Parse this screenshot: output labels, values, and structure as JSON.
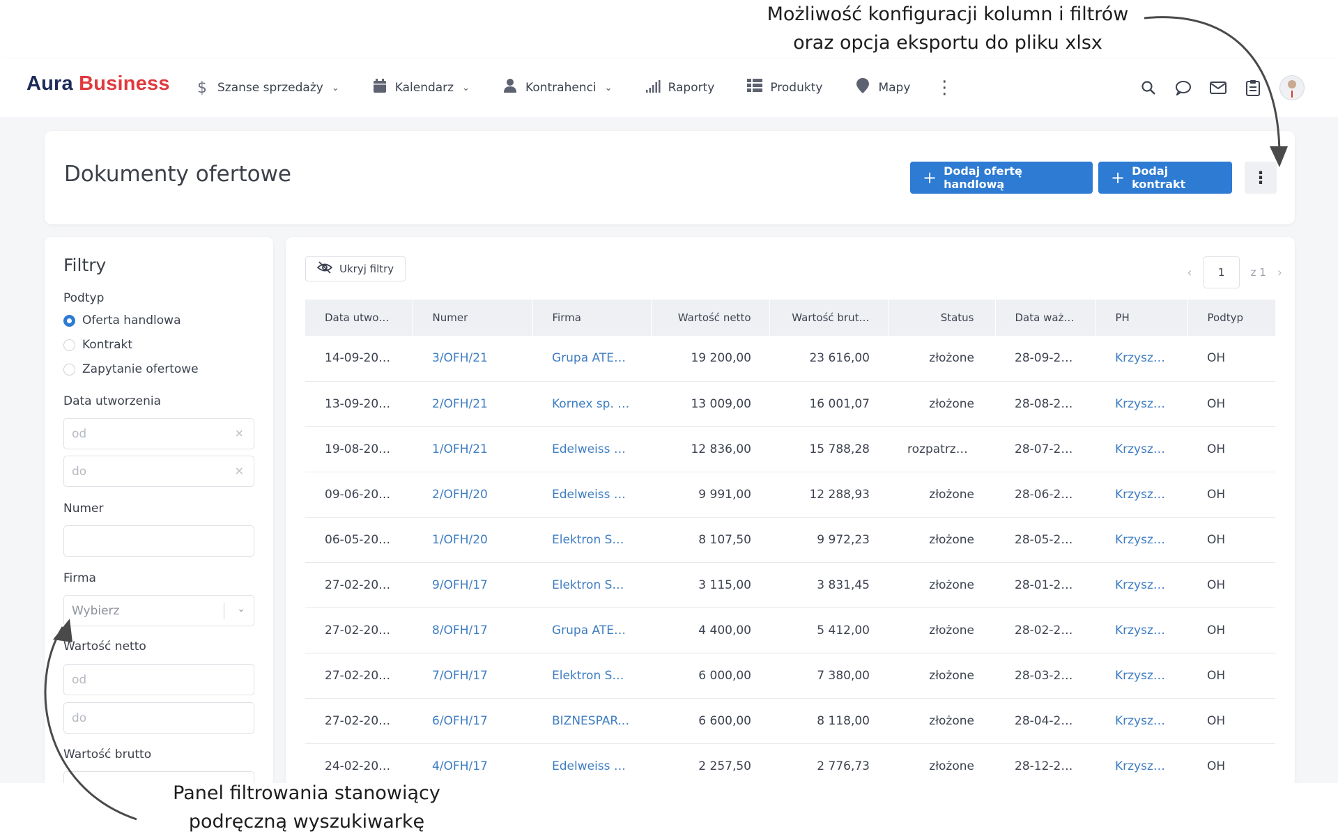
{
  "annotations": {
    "top_line1": "Możliwość konfiguracji kolumn i filtrów",
    "top_line2": "oraz opcja eksportu do pliku xlsx",
    "bottom_line1": "Panel filtrowania stanowiący",
    "bottom_line2": "podręczną wyszukiwarkę"
  },
  "brand": {
    "part1": "Aura",
    "part2": "Business",
    "color1": "#1c2b5a",
    "color2": "#e0393e"
  },
  "nav": [
    {
      "label": "Szanse sprzedaży",
      "icon": "dollar-icon",
      "dropdown": true
    },
    {
      "label": "Kalendarz",
      "icon": "calendar-icon",
      "dropdown": true
    },
    {
      "label": "Kontrahenci",
      "icon": "person-icon",
      "dropdown": true
    },
    {
      "label": "Raporty",
      "icon": "signal-bars-icon",
      "dropdown": false
    },
    {
      "label": "Produkty",
      "icon": "list-grid-icon",
      "dropdown": false
    },
    {
      "label": "Mapy",
      "icon": "map-pin-icon",
      "dropdown": false
    }
  ],
  "header": {
    "title": "Dokumenty ofertowe",
    "add_offer": "Dodaj ofertę handlową",
    "add_contract": "Dodaj kontrakt"
  },
  "accent_color": "#2d7bd3",
  "filters": {
    "title": "Filtry",
    "podtyp_label": "Podtyp",
    "podtyp_options": [
      {
        "label": "Oferta handlowa",
        "selected": true
      },
      {
        "label": "Kontrakt",
        "selected": false
      },
      {
        "label": "Zapytanie ofertowe",
        "selected": false
      }
    ],
    "data_label": "Data utworzenia",
    "from_placeholder": "od",
    "to_placeholder": "do",
    "numer_label": "Numer",
    "firma_label": "Firma",
    "firma_placeholder": "Wybierz",
    "netto_label": "Wartość netto",
    "brutto_label": "Wartość brutto"
  },
  "table": {
    "hide_filters": "Ukryj filtry",
    "page": "1",
    "page_of": "z 1",
    "columns": [
      "Data utwor…",
      "Numer",
      "Firma",
      "Wartość netto",
      "Wartość brut…",
      "Status",
      "Data waż…",
      "PH",
      "Podtyp"
    ],
    "rows": [
      [
        "14-09-20…",
        "3/OFH/21",
        "Grupa ATE…",
        "19 200,00",
        "23 616,00",
        "złożone",
        "28-09-2…",
        "Krzyszt…",
        "OH"
      ],
      [
        "13-09-20…",
        "2/OFH/21",
        "Kornex sp. …",
        "13 009,00",
        "16 001,07",
        "złożone",
        "28-08-2…",
        "Krzyszt…",
        "OH"
      ],
      [
        "19-08-20…",
        "1/OFH/21",
        "Edelweiss S…",
        "12 836,00",
        "15 788,28",
        "rozpatrzo…",
        "28-07-2…",
        "Krzyszt…",
        "OH"
      ],
      [
        "09-06-20…",
        "2/OFH/20",
        "Edelweiss S…",
        "9 991,00",
        "12 288,93",
        "złożone",
        "28-06-2…",
        "Krzyszt…",
        "OH"
      ],
      [
        "06-05-20…",
        "1/OFH/20",
        "Elektron Sp…",
        "8 107,50",
        "9 972,23",
        "złożone",
        "28-05-2…",
        "Krzyszt…",
        "OH"
      ],
      [
        "27-02-20…",
        "9/OFH/17",
        "Elektron Sp…",
        "3 115,00",
        "3 831,45",
        "złożone",
        "28-01-2…",
        "Krzyszt…",
        "OH"
      ],
      [
        "27-02-20…",
        "8/OFH/17",
        "Grupa ATE…",
        "4 400,00",
        "5 412,00",
        "złożone",
        "28-02-2…",
        "Krzyszt…",
        "OH"
      ],
      [
        "27-02-20…",
        "7/OFH/17",
        "Elektron Sp…",
        "6 000,00",
        "7 380,00",
        "złożone",
        "28-03-2…",
        "Krzyszt…",
        "OH"
      ],
      [
        "27-02-20…",
        "6/OFH/17",
        "BIZNESPART…",
        "6 600,00",
        "8 118,00",
        "złożone",
        "28-04-2…",
        "Krzyszt…",
        "OH"
      ],
      [
        "24-02-20…",
        "4/OFH/17",
        "Edelweiss S…",
        "2 257,50",
        "2 776,73",
        "złożone",
        "28-12-2…",
        "Krzyszt…",
        "OH"
      ]
    ]
  }
}
